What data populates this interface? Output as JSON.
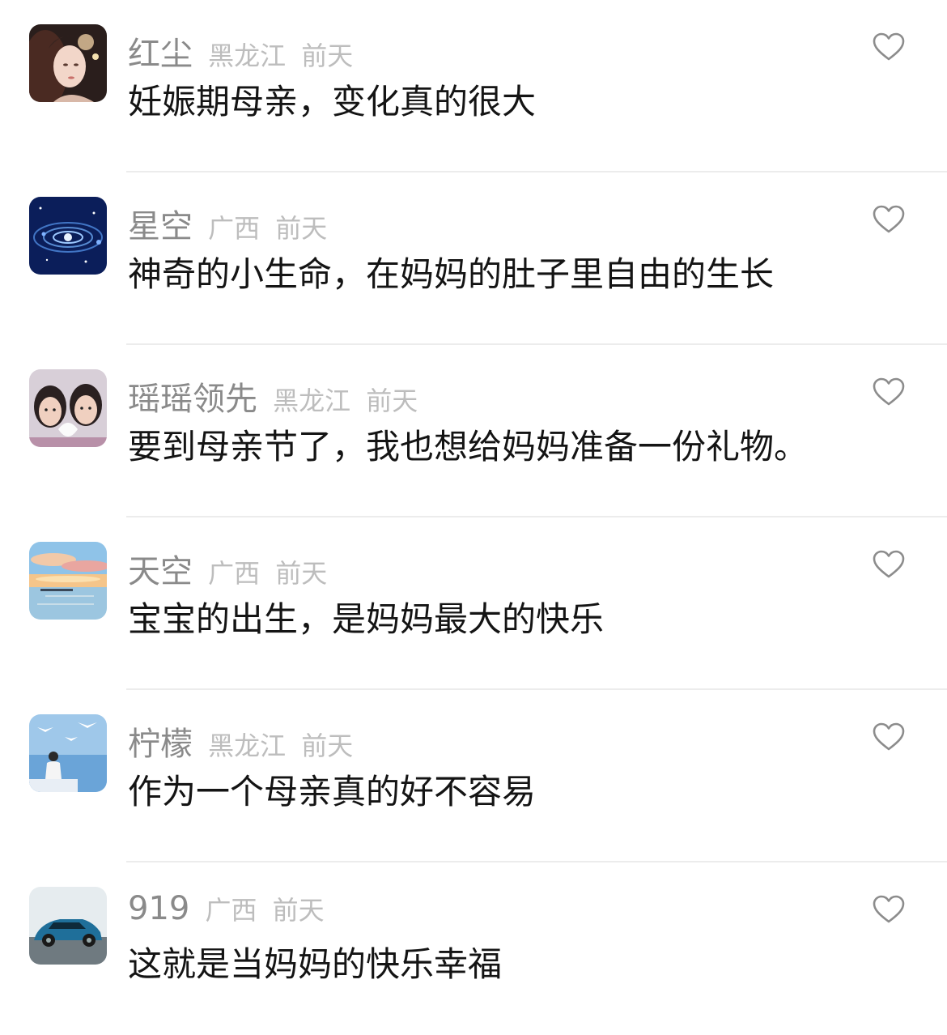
{
  "comments": [
    {
      "name": "红尘",
      "location": "黑龙江",
      "time": "前天",
      "text": "妊娠期母亲，变化真的很大",
      "avatar": "woman-portrait-avatar",
      "like_icon": "heart-outline-icon"
    },
    {
      "name": "星空",
      "location": "广西",
      "time": "前天",
      "text": "神奇的小生命，在妈妈的肚子里自由的生长",
      "avatar": "galaxy-avatar",
      "like_icon": "heart-outline-icon"
    },
    {
      "name": "瑶瑶领先",
      "location": "黑龙江",
      "time": "前天",
      "text": "要到母亲节了，我也想给妈妈准备一份礼物。",
      "avatar": "two-girls-avatar",
      "like_icon": "heart-outline-icon"
    },
    {
      "name": "天空",
      "location": "广西",
      "time": "前天",
      "text": "宝宝的出生，是妈妈最大的快乐",
      "avatar": "sunset-sea-avatar",
      "like_icon": "heart-outline-icon"
    },
    {
      "name": "柠檬",
      "location": "黑龙江",
      "time": "前天",
      "text": "作为一个母亲真的好不容易",
      "avatar": "girl-with-birds-avatar",
      "like_icon": "heart-outline-icon"
    },
    {
      "name": "919",
      "location": "广西",
      "time": "前天",
      "text": "这就是当妈妈的快乐幸福",
      "avatar": "blue-car-avatar",
      "like_icon": "heart-outline-icon"
    }
  ],
  "colors": {
    "name": "#8a8a8a",
    "meta": "#bdbdbd",
    "text": "#141414",
    "divider": "#ececec",
    "heart": "#8c8c8c"
  }
}
